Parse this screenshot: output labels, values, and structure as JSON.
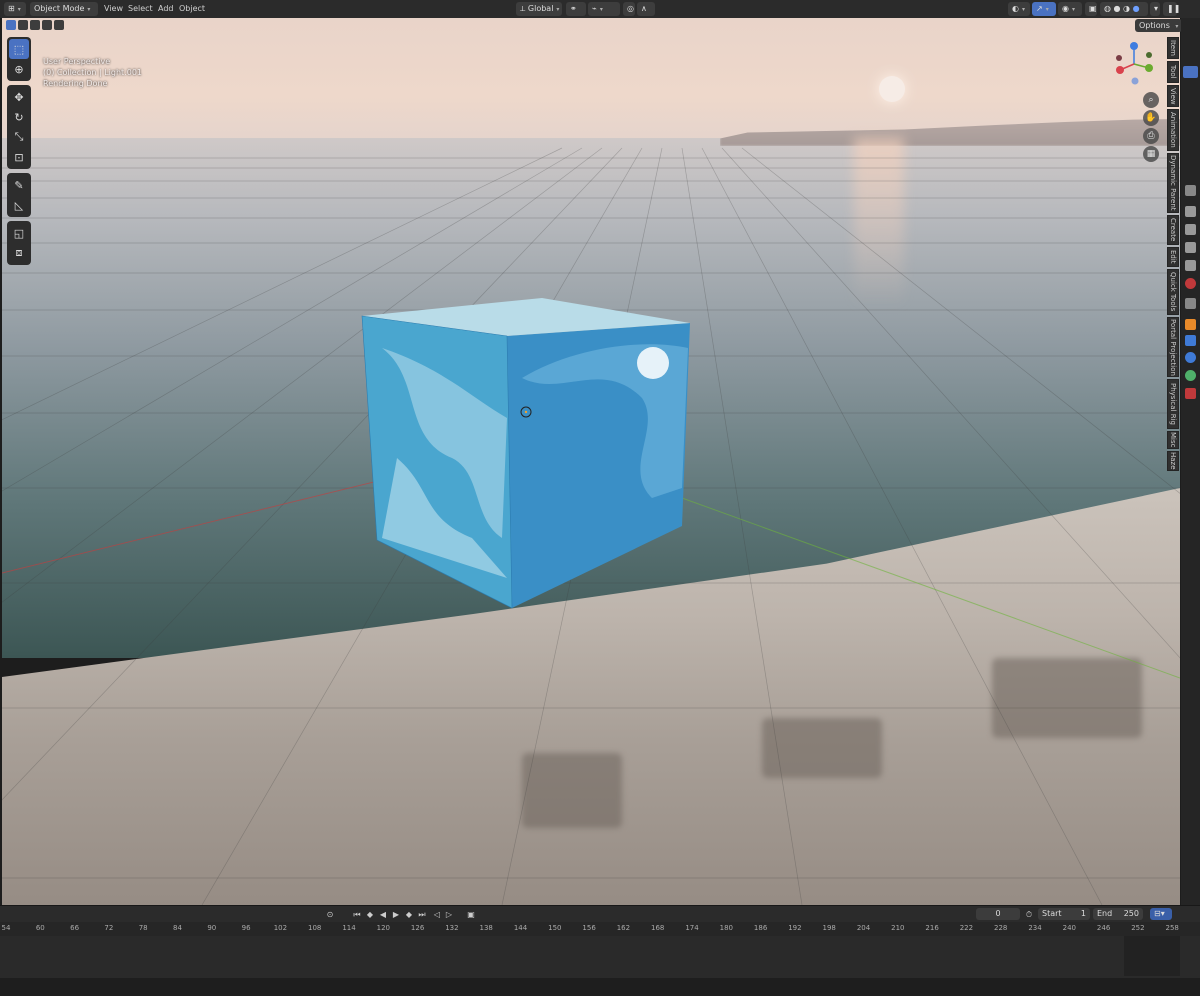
{
  "header": {
    "mode_label": "Object Mode",
    "menus": [
      "View",
      "Select",
      "Add",
      "Object"
    ],
    "orientation_label": "Global",
    "options_label": "Options"
  },
  "viewport_overlay": {
    "line1": "User Perspective",
    "line2": "(0) Collection | Light.001",
    "line3": "Rendering Done"
  },
  "gizmo": {
    "colors": {
      "x": "#d9424c",
      "y": "#6bab2f",
      "z": "#3d7ce0"
    }
  },
  "side_tabs": [
    "Item",
    "Tool",
    "View",
    "Animation",
    "Dynamic Parent",
    "Create",
    "Edit",
    "Quick Tools",
    "Portal Projection",
    "Physical Rig",
    "Misc",
    "Haze"
  ],
  "timeline": {
    "current_frame": "0",
    "start_label": "Start",
    "start_value": "1",
    "end_label": "End",
    "end_value": "250",
    "ruler": [
      "54",
      "60",
      "66",
      "72",
      "78",
      "84",
      "90",
      "96",
      "102",
      "108",
      "114",
      "120",
      "126",
      "132",
      "138",
      "144",
      "150",
      "156",
      "162",
      "168",
      "174",
      "180",
      "186",
      "192",
      "198",
      "204",
      "210",
      "216",
      "222",
      "228",
      "234",
      "240",
      "246",
      "252",
      "258"
    ]
  },
  "icons": [
    "select-box-icon",
    "cursor-icon",
    "move-icon",
    "rotate-icon",
    "scale-icon",
    "transform-icon",
    "annotate-icon",
    "measure-icon",
    "add-cube-icon",
    "extrude-icon",
    "zoom-icon",
    "hand-pan-icon",
    "camera-icon",
    "grid-view-icon"
  ]
}
